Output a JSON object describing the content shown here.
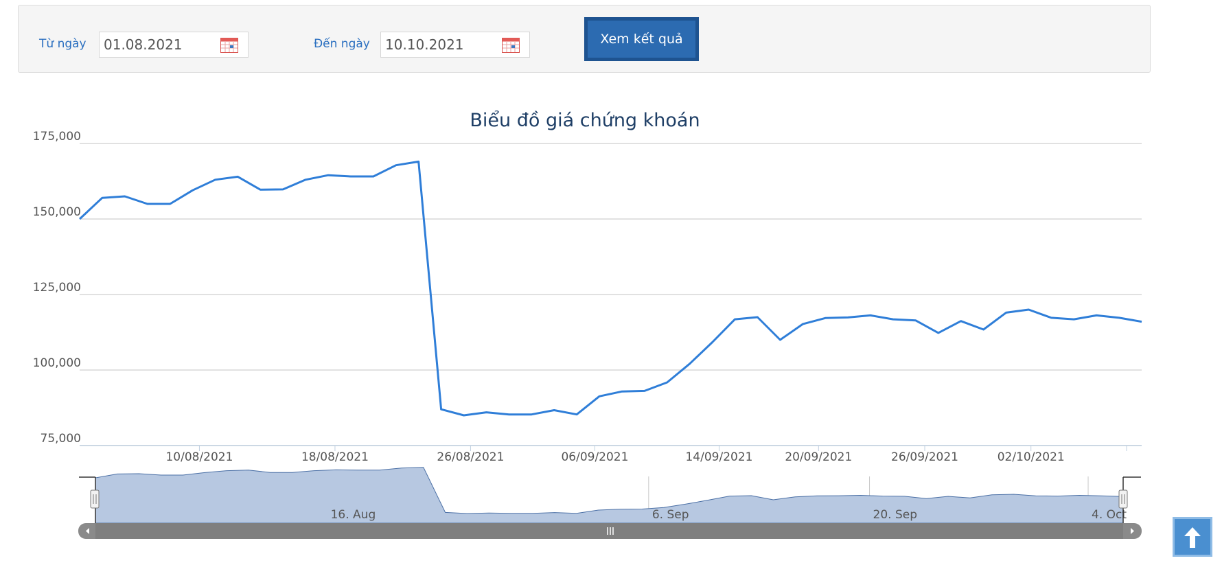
{
  "filter": {
    "from_label": "Từ ngày",
    "from_value": "01.08.2021",
    "to_label": "Đến ngày",
    "to_value": "10.10.2021",
    "submit_label": "Xem kết quả"
  },
  "icons": {
    "calendar": "calendar-icon",
    "scroll_top": "arrow-up-icon",
    "nav_handle": "grip-lines-icon",
    "nav_arrow_left": "chevron-left-icon",
    "nav_arrow_right": "chevron-right-icon"
  },
  "colors": {
    "line": "#2f7ed8",
    "navigator_fill": "#b7c8e1",
    "button": "#2c6bb1",
    "title": "#1f3f66"
  },
  "chart_data": {
    "type": "line",
    "title": "Biểu đồ giá chứng khoán",
    "xlabel": "",
    "ylabel": "",
    "ylim": [
      75000,
      175000
    ],
    "y_ticks": [
      "75,000",
      "100,000",
      "125,000",
      "150,000",
      "175,000"
    ],
    "x_ticks": [
      "10/08/2021",
      "18/08/2021",
      "26/08/2021",
      "06/09/2021",
      "14/09/2021",
      "20/09/2021",
      "26/09/2021",
      "02/10/2021"
    ],
    "navigator_ticks": [
      "16. Aug",
      "6. Sep",
      "20. Sep",
      "4. Oct"
    ],
    "grid": true,
    "legend": "none",
    "series": [
      {
        "values": [
          150000,
          157000,
          157500,
          155000,
          155000,
          159500,
          163000,
          164000,
          159700,
          159800,
          163000,
          164500,
          164100,
          164100,
          167800,
          169000,
          87000,
          85000,
          86000,
          85300,
          85300,
          86700,
          85300,
          91300,
          92900,
          93100,
          95900,
          102100,
          109200,
          116800,
          117500,
          110000,
          115200,
          117200,
          117400,
          118100,
          116800,
          116400,
          112300,
          116200,
          113400,
          119000,
          120000,
          117300,
          116800,
          118100,
          117300,
          116000
        ]
      }
    ]
  }
}
